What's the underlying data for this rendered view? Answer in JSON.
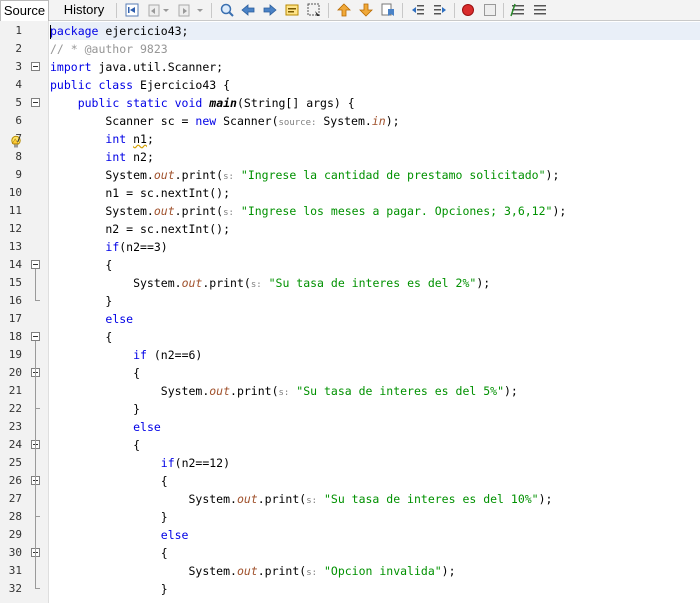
{
  "tabs": [
    {
      "label": "Source",
      "active": true
    },
    {
      "label": "History",
      "active": false
    }
  ],
  "toolbar_icons": [
    "last-edit-icon",
    "back-icon",
    "forward-icon",
    "find-selection-icon",
    "find-previous-icon",
    "find-next-icon",
    "toggle-highlight-icon",
    "rectangle-selection-icon",
    "previous-bookmark-icon",
    "next-bookmark-icon",
    "toggle-bookmark-icon",
    "shift-left-icon",
    "shift-right-icon",
    "start-macro-recording-icon",
    "stop-macro-recording-icon",
    "comment-icon",
    "uncomment-icon"
  ],
  "colors": {
    "keyword": "#0000e6",
    "string": "#ce7b00",
    "field": "#a0522d",
    "comment": "#969696",
    "current_line": "#e9eff8",
    "record": "#d92c2c"
  },
  "editor": {
    "line_numbers": [
      "1",
      "2",
      "3",
      "4",
      "5",
      "6",
      "7",
      "8",
      "9",
      "10",
      "11",
      "12",
      "13",
      "14",
      "15",
      "16",
      "17",
      "18",
      "19",
      "20",
      "21",
      "22",
      "23",
      "24",
      "25",
      "26",
      "27",
      "28",
      "29",
      "30",
      "31",
      "32"
    ],
    "warning_line": "8",
    "lines": [
      {
        "parts": [
          {
            "t": "package",
            "c": "kw"
          },
          {
            "t": " ejercicio43;"
          }
        ]
      },
      {
        "parts": [
          {
            "t": "// * @author 9823",
            "c": "cm"
          }
        ]
      },
      {
        "parts": [
          {
            "t": "import",
            "c": "kw"
          },
          {
            "t": " java.util.Scanner;"
          }
        ]
      },
      {
        "parts": [
          {
            "t": "public class",
            "c": "kw"
          },
          {
            "t": " Ejercicio43 {"
          }
        ]
      },
      {
        "parts": [
          {
            "t": "    "
          },
          {
            "t": "public static void",
            "c": "kw"
          },
          {
            "t": " "
          },
          {
            "t": "main",
            "c": "mth"
          },
          {
            "t": "(String[] args) {"
          }
        ]
      },
      {
        "parts": [
          {
            "t": "        Scanner sc = "
          },
          {
            "t": "new",
            "c": "kw"
          },
          {
            "t": " Scanner("
          },
          {
            "t": "source:",
            "c": "hint"
          },
          {
            "t": " System."
          },
          {
            "t": "in",
            "c": "fld"
          },
          {
            "t": ");"
          }
        ]
      },
      {
        "parts": [
          {
            "t": "        "
          },
          {
            "t": "int",
            "c": "kw"
          },
          {
            "t": " "
          },
          {
            "t": "n1",
            "c": "warn"
          },
          {
            "t": ";"
          }
        ]
      },
      {
        "parts": [
          {
            "t": "        "
          },
          {
            "t": "int",
            "c": "kw"
          },
          {
            "t": " n2;"
          }
        ]
      },
      {
        "parts": [
          {
            "t": "        System."
          },
          {
            "t": "out",
            "c": "fld"
          },
          {
            "t": ".print("
          },
          {
            "t": "s:",
            "c": "hint"
          },
          {
            "t": " "
          },
          {
            "t": "\"Ingrese la cantidad de prestamo solicitado\"",
            "c": "s2"
          },
          {
            "t": ");"
          }
        ]
      },
      {
        "parts": [
          {
            "t": "        n1 = sc.nextInt();"
          }
        ]
      },
      {
        "parts": [
          {
            "t": "        System."
          },
          {
            "t": "out",
            "c": "fld"
          },
          {
            "t": ".print("
          },
          {
            "t": "s:",
            "c": "hint"
          },
          {
            "t": " "
          },
          {
            "t": "\"Ingrese los meses a pagar. Opciones; 3,6,12\"",
            "c": "s2"
          },
          {
            "t": ");"
          }
        ]
      },
      {
        "parts": [
          {
            "t": "        n2 = sc.nextInt();"
          }
        ]
      },
      {
        "parts": [
          {
            "t": "        "
          },
          {
            "t": "if",
            "c": "kw"
          },
          {
            "t": "(n2==3)"
          }
        ]
      },
      {
        "parts": [
          {
            "t": "        {"
          }
        ]
      },
      {
        "parts": [
          {
            "t": "            System."
          },
          {
            "t": "out",
            "c": "fld"
          },
          {
            "t": ".print("
          },
          {
            "t": "s:",
            "c": "hint"
          },
          {
            "t": " "
          },
          {
            "t": "\"Su tasa de interes es del 2%\"",
            "c": "s2"
          },
          {
            "t": ");"
          }
        ]
      },
      {
        "parts": [
          {
            "t": "        }"
          }
        ]
      },
      {
        "parts": [
          {
            "t": "        "
          },
          {
            "t": "else",
            "c": "kw"
          }
        ]
      },
      {
        "parts": [
          {
            "t": "        {"
          }
        ]
      },
      {
        "parts": [
          {
            "t": "            "
          },
          {
            "t": "if",
            "c": "kw"
          },
          {
            "t": " (n2==6)"
          }
        ]
      },
      {
        "parts": [
          {
            "t": "            {"
          }
        ]
      },
      {
        "parts": [
          {
            "t": "                System."
          },
          {
            "t": "out",
            "c": "fld"
          },
          {
            "t": ".print("
          },
          {
            "t": "s:",
            "c": "hint"
          },
          {
            "t": " "
          },
          {
            "t": "\"Su tasa de interes es del 5%\"",
            "c": "s2"
          },
          {
            "t": ");"
          }
        ]
      },
      {
        "parts": [
          {
            "t": "            }"
          }
        ]
      },
      {
        "parts": [
          {
            "t": "            "
          },
          {
            "t": "else",
            "c": "kw"
          }
        ]
      },
      {
        "parts": [
          {
            "t": "            {"
          }
        ]
      },
      {
        "parts": [
          {
            "t": "                "
          },
          {
            "t": "if",
            "c": "kw"
          },
          {
            "t": "(n2==12)"
          }
        ]
      },
      {
        "parts": [
          {
            "t": "                {"
          }
        ]
      },
      {
        "parts": [
          {
            "t": "                    System."
          },
          {
            "t": "out",
            "c": "fld"
          },
          {
            "t": ".print("
          },
          {
            "t": "s:",
            "c": "hint"
          },
          {
            "t": " "
          },
          {
            "t": "\"Su tasa de interes es del 10%\"",
            "c": "s2"
          },
          {
            "t": ");"
          }
        ]
      },
      {
        "parts": [
          {
            "t": "                }"
          }
        ]
      },
      {
        "parts": [
          {
            "t": "                "
          },
          {
            "t": "else",
            "c": "kw"
          }
        ]
      },
      {
        "parts": [
          {
            "t": "                {"
          }
        ]
      },
      {
        "parts": [
          {
            "t": "                    System."
          },
          {
            "t": "out",
            "c": "fld"
          },
          {
            "t": ".print("
          },
          {
            "t": "s:",
            "c": "hint"
          },
          {
            "t": " "
          },
          {
            "t": "\"Opcion invalida\"",
            "c": "s2"
          },
          {
            "t": ");"
          }
        ]
      },
      {
        "parts": [
          {
            "t": "                }"
          }
        ]
      }
    ]
  }
}
